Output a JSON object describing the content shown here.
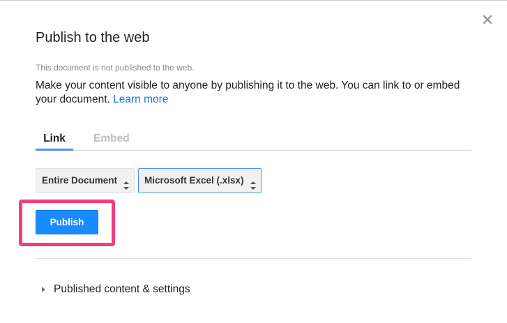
{
  "dialog": {
    "title": "Publish to the web",
    "status": "This document is not published to the web.",
    "description": "Make your content visible to anyone by publishing it to the web. You can link to or embed your document.",
    "learn_more": "Learn more",
    "close_icon": "close-icon"
  },
  "tabs": [
    {
      "label": "Link",
      "active": true
    },
    {
      "label": "Embed",
      "active": false
    }
  ],
  "selects": {
    "scope": "Entire Document",
    "format": "Microsoft Excel (.xlsx)"
  },
  "publish_button": "Publish",
  "highlight_color": "#f43e7e",
  "accent_color": "#1a8cff",
  "expander": {
    "label": "Published content & settings",
    "expanded": false
  }
}
